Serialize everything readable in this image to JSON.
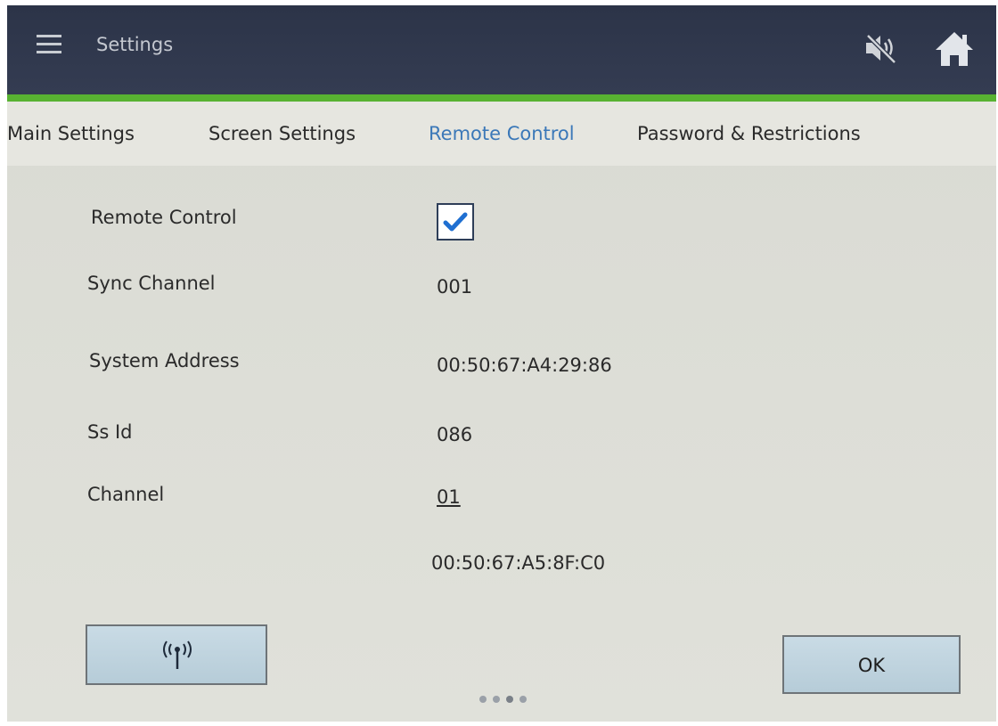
{
  "header": {
    "title": "Settings",
    "icons": [
      "menu-icon",
      "mute-icon",
      "home-icon"
    ]
  },
  "tabs": [
    {
      "label": "Main Settings",
      "active": false
    },
    {
      "label": "Screen Settings",
      "active": false
    },
    {
      "label": "Remote Control",
      "active": true
    },
    {
      "label": "Password & Restrictions",
      "active": false
    }
  ],
  "form": {
    "remote_control": {
      "label": "Remote Control",
      "checked": true
    },
    "sync_channel": {
      "label": "Sync Channel",
      "value": "001"
    },
    "system_address": {
      "label": "System Address",
      "value": "00:50:67:A4:29:86"
    },
    "ss_id": {
      "label": "Ss Id",
      "value": "086"
    },
    "channel": {
      "label": "Channel",
      "value": "01"
    },
    "device_address": {
      "value": "00:50:67:A5:8F:C0"
    }
  },
  "buttons": {
    "wireless_icon": "wireless-antenna-icon",
    "ok_label": "OK"
  },
  "pagination": {
    "count": 4
  },
  "colors": {
    "header_bg": "#2f3749",
    "accent_green": "#58b232",
    "active_tab": "#3b78b8",
    "checkmark": "#1f6fd1",
    "button_bg": "#c3d6e1"
  }
}
